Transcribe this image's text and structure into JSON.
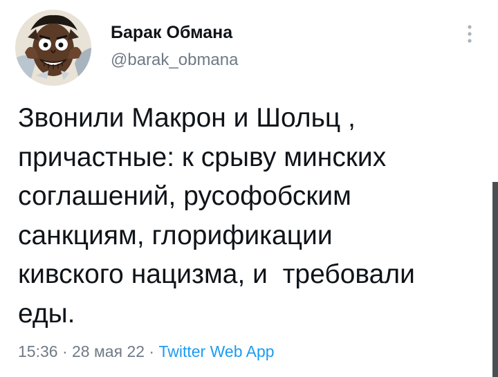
{
  "author": {
    "display_name": "Барак Обмана",
    "handle": "@barak_obmana",
    "avatar_icon": "caricature-avatar-icon"
  },
  "more_icon": "vertical-ellipsis-icon",
  "tweet": {
    "lines": [
      "Звонили Макрон и Шольц ,",
      "причастные: к срыву минских",
      "соглашений, русофобским",
      "санкциям, глорификации",
      "кивского нацизма, и  требовали",
      "еды."
    ]
  },
  "meta": {
    "time": "15:36",
    "separator": " · ",
    "date": "28 мая 22",
    "source": "Twitter Web App"
  },
  "colors": {
    "text": "#0f1419",
    "secondary": "#6f7a86",
    "link": "#1d9bf0",
    "scrollbar": "#4a4f54"
  }
}
